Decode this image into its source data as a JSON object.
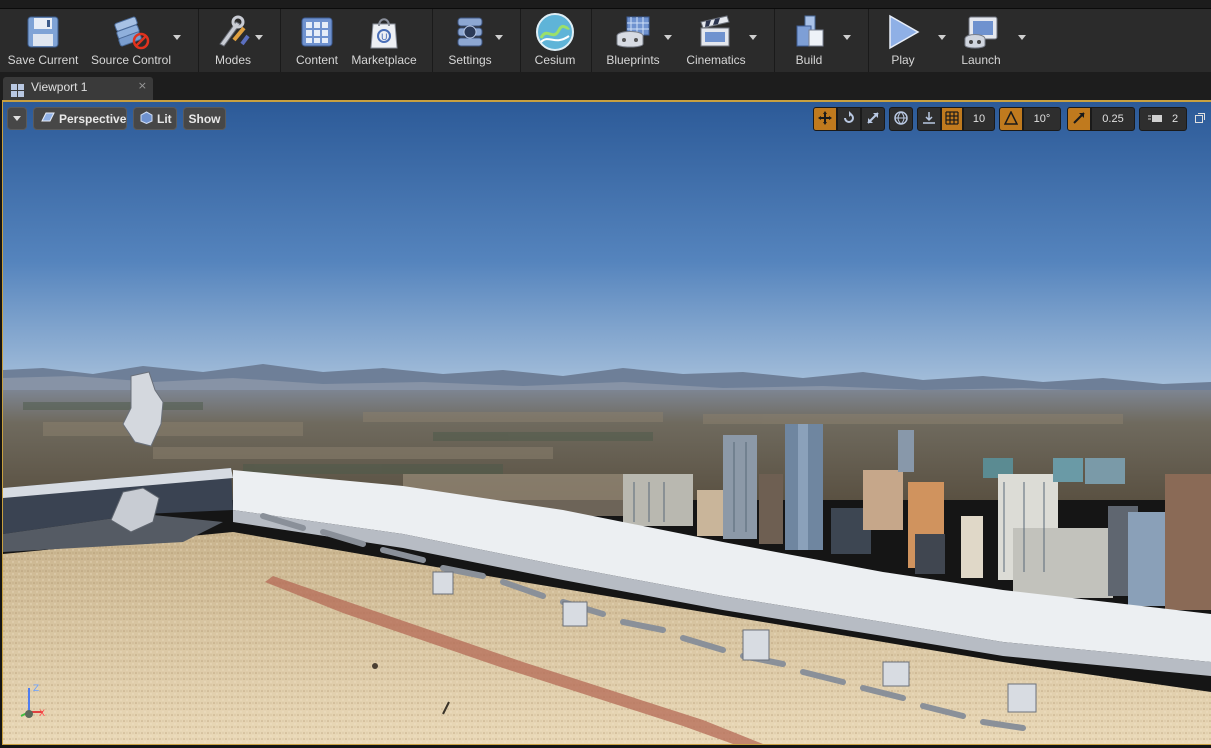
{
  "toolbar": {
    "items": [
      {
        "label": "Save Current",
        "icon": "save-icon"
      },
      {
        "label": "Source Control",
        "icon": "source-control-icon"
      },
      {
        "label": "Modes",
        "icon": "modes-icon"
      },
      {
        "label": "Content",
        "icon": "content-icon"
      },
      {
        "label": "Marketplace",
        "icon": "marketplace-icon"
      },
      {
        "label": "Settings",
        "icon": "settings-icon"
      },
      {
        "label": "Cesium",
        "icon": "cesium-icon"
      },
      {
        "label": "Blueprints",
        "icon": "blueprints-icon"
      },
      {
        "label": "Cinematics",
        "icon": "cinematics-icon"
      },
      {
        "label": "Build",
        "icon": "build-icon"
      },
      {
        "label": "Play",
        "icon": "play-icon"
      },
      {
        "label": "Launch",
        "icon": "launch-icon"
      }
    ]
  },
  "tabs": {
    "viewport": {
      "label": "Viewport 1",
      "close": "×"
    }
  },
  "viewport": {
    "left": {
      "perspective_label": "Perspective",
      "lit_label": "Lit",
      "show_label": "Show"
    },
    "right": {
      "grid_snap_value": "10",
      "rotation_snap_value": "10°",
      "scale_snap_value": "0.25",
      "camera_speed_value": "2"
    },
    "axis": {
      "z": "Z",
      "x": "X"
    }
  },
  "colors": {
    "accent": "#c8a040",
    "toolbar_bg": "#2b2b2b",
    "active_toggle": "#c07a1e",
    "sky_top": "#2f5f9e",
    "sky_horizon": "#9bb8d6"
  }
}
